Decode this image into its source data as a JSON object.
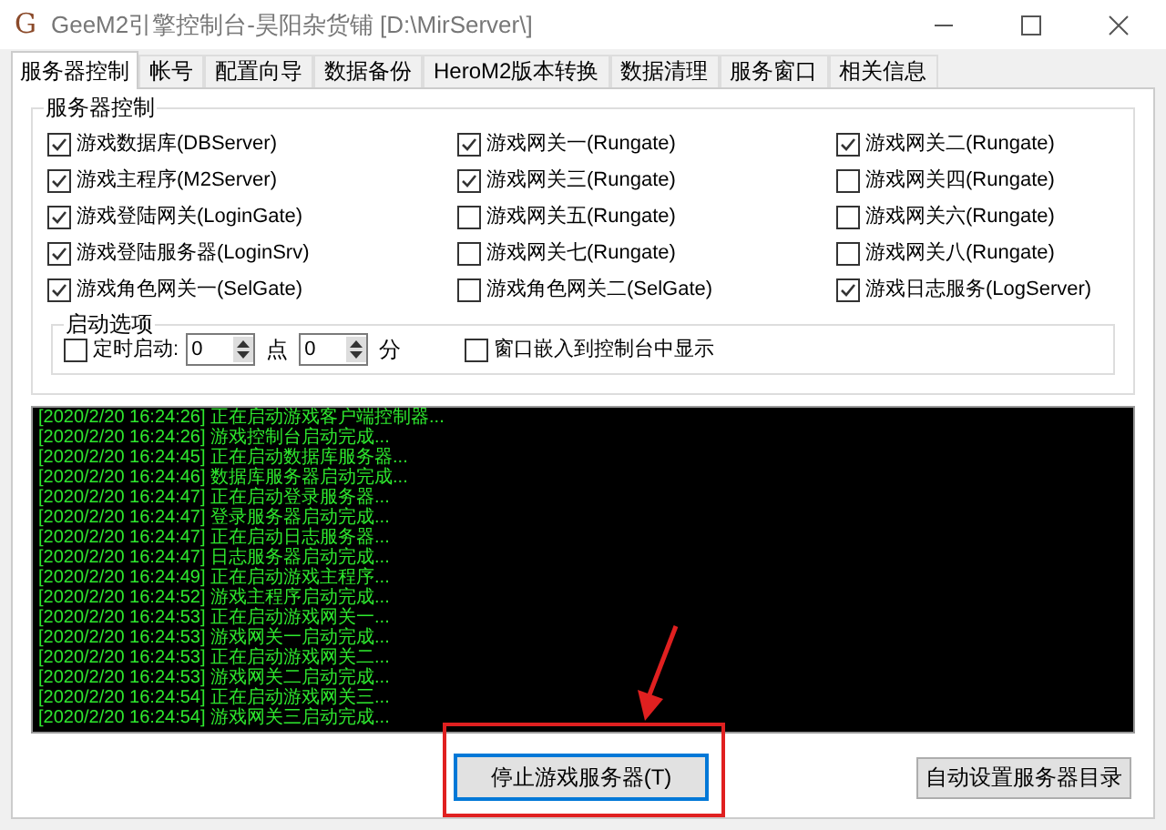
{
  "window": {
    "icon_letter": "G",
    "title": "GeeM2引擎控制台-昊阳杂货铺 [D:\\MirServer\\]"
  },
  "tabs": [
    {
      "label": "服务器控制",
      "selected": true
    },
    {
      "label": "帐号",
      "selected": false
    },
    {
      "label": "配置向导",
      "selected": false
    },
    {
      "label": "数据备份",
      "selected": false
    },
    {
      "label": "HeroM2版本转换",
      "selected": false
    },
    {
      "label": "数据清理",
      "selected": false
    },
    {
      "label": "服务窗口",
      "selected": false
    },
    {
      "label": "相关信息",
      "selected": false
    }
  ],
  "server_control": {
    "title": "服务器控制",
    "items": [
      {
        "label": "游戏数据库(DBServer)",
        "checked": true
      },
      {
        "label": "游戏网关一(Rungate)",
        "checked": true
      },
      {
        "label": "游戏网关二(Rungate)",
        "checked": true
      },
      {
        "label": "游戏主程序(M2Server)",
        "checked": true
      },
      {
        "label": "游戏网关三(Rungate)",
        "checked": true
      },
      {
        "label": "游戏网关四(Rungate)",
        "checked": false
      },
      {
        "label": "游戏登陆网关(LoginGate)",
        "checked": true
      },
      {
        "label": "游戏网关五(Rungate)",
        "checked": false
      },
      {
        "label": "游戏网关六(Rungate)",
        "checked": false
      },
      {
        "label": "游戏登陆服务器(LoginSrv)",
        "checked": true
      },
      {
        "label": "游戏网关七(Rungate)",
        "checked": false
      },
      {
        "label": "游戏网关八(Rungate)",
        "checked": false
      },
      {
        "label": "游戏角色网关一(SelGate)",
        "checked": true
      },
      {
        "label": "游戏角色网关二(SelGate)",
        "checked": false
      },
      {
        "label": "游戏日志服务(LogServer)",
        "checked": true
      }
    ]
  },
  "startup_options": {
    "title": "启动选项",
    "scheduled": {
      "label": "定时启动:",
      "checked": false
    },
    "hour_value": "0",
    "hour_unit": "点",
    "minute_value": "0",
    "minute_unit": "分",
    "embed": {
      "label": "窗口嵌入到控制台中显示",
      "checked": false
    }
  },
  "log": [
    "[2020/2/20 16:24:26] 正在启动游戏客户端控制器...",
    "[2020/2/20 16:24:26] 游戏控制台启动完成...",
    "[2020/2/20 16:24:45] 正在启动数据库服务器...",
    "[2020/2/20 16:24:46] 数据库服务器启动完成...",
    "[2020/2/20 16:24:47] 正在启动登录服务器...",
    "[2020/2/20 16:24:47] 登录服务器启动完成...",
    "[2020/2/20 16:24:47] 正在启动日志服务器...",
    "[2020/2/20 16:24:47] 日志服务器启动完成...",
    "[2020/2/20 16:24:49] 正在启动游戏主程序...",
    "[2020/2/20 16:24:52] 游戏主程序启动完成...",
    "[2020/2/20 16:24:53] 正在启动游戏网关一...",
    "[2020/2/20 16:24:53] 游戏网关一启动完成...",
    "[2020/2/20 16:24:53] 正在启动游戏网关二...",
    "[2020/2/20 16:24:53] 游戏网关二启动完成...",
    "[2020/2/20 16:24:54] 正在启动游戏网关三...",
    "[2020/2/20 16:24:54] 游戏网关三启动完成..."
  ],
  "buttons": {
    "stop": "停止游戏服务器(T)",
    "auto_dir": "自动设置服务器目录"
  }
}
